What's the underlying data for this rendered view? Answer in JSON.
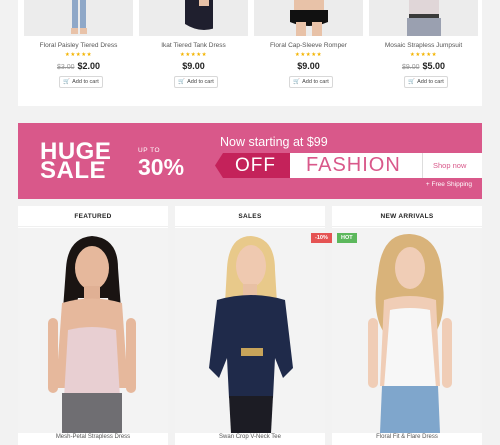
{
  "products": [
    {
      "name": "Floral Paisley Tiered Dress",
      "stars": "★★★★★",
      "old_price": "$3.00",
      "price": "$2.00",
      "cart": "Add to cart"
    },
    {
      "name": "Ikat Tiered Tank Dress",
      "stars": "★★★★★",
      "old_price": "",
      "price": "$9.00",
      "cart": "Add to cart"
    },
    {
      "name": "Floral Cap-Sleeve Romper",
      "stars": "★★★★★",
      "old_price": "",
      "price": "$9.00",
      "cart": "Add to cart"
    },
    {
      "name": "Mosaic Strapless Jumpsuit",
      "stars": "★★★★★",
      "old_price": "$9.00",
      "price": "$5.00",
      "cart": "Add to cart"
    }
  ],
  "banner": {
    "huge": "HUGE",
    "sale": "SALE",
    "up_to": "UP TO",
    "percent": "30%",
    "starting": "Now starting at $99",
    "off": "OFF",
    "fashion": "FASHION",
    "shop_now": "Shop now",
    "shipping": "+ Free Shipping",
    "color": "#d9588a",
    "accent": "#c4225a"
  },
  "cards": [
    {
      "header": "FEATURED",
      "name": "Mesh-Petal Strapless Dress"
    },
    {
      "header": "SALES",
      "name": "Swan Crop V-Neck Tee",
      "badge": "-10%"
    },
    {
      "header": "NEW ARRIVALS",
      "name": "Floral Fit & Flare Dress",
      "badge": "HOT"
    }
  ],
  "colors": {
    "stars": "#f4b400",
    "hot": "#5cb85c",
    "sale_badge": "#e55353"
  }
}
